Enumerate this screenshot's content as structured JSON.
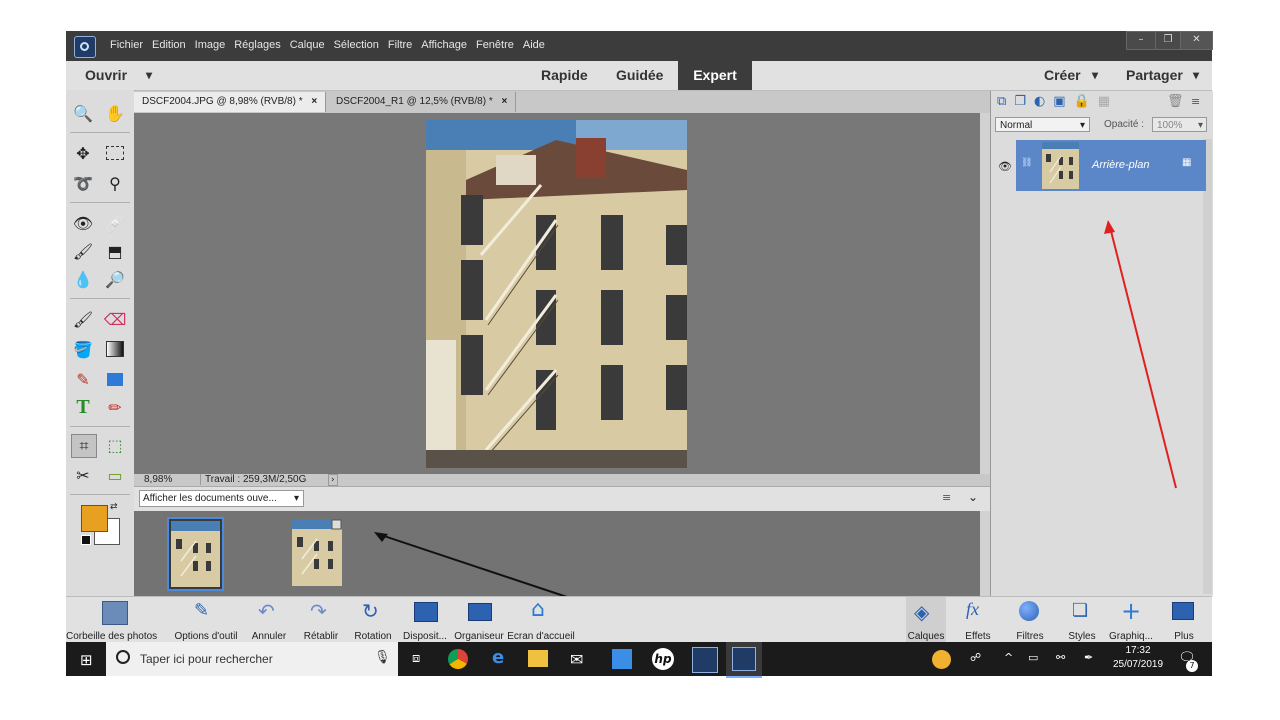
{
  "menu": {
    "items": [
      "Fichier",
      "Edition",
      "Image",
      "Réglages",
      "Calque",
      "Sélection",
      "Filtre",
      "Affichage",
      "Fenêtre",
      "Aide"
    ],
    "window_buttons": [
      "–",
      "❐",
      "✕"
    ]
  },
  "modebar": {
    "open_label": "Ouvrir",
    "modes": [
      "Rapide",
      "Guidée",
      "Expert"
    ],
    "active_mode": "Expert",
    "create_label": "Créer",
    "share_label": "Partager"
  },
  "tabs": [
    {
      "label": "DSCF2004.JPG @ 8,98% (RVB/8) *",
      "close": "×",
      "active": true
    },
    {
      "label": "DSCF2004_R1 @ 12,5% (RVB/8) *",
      "close": "×",
      "active": false
    }
  ],
  "status": {
    "zoom": "8,98%",
    "work": "Travail : 259,3M/2,50G"
  },
  "bin": {
    "dropdown": "Afficher les documents ouve...",
    "thumbnails": 2
  },
  "layers": {
    "blend_mode": "Normal",
    "opacity_label": "Opacité :",
    "opacity_value": "100%",
    "layer_name": "Arrière-plan"
  },
  "bottombar": {
    "left_items": [
      "Corbeille des photos",
      "Options d'outil",
      "Annuler",
      "Rétablir",
      "Rotation",
      "Disposit...",
      "Organiseur",
      "Ecran d'accueil"
    ],
    "right_items": [
      "Calques",
      "Effets",
      "Filtres",
      "Styles",
      "Graphiq...",
      "Plus"
    ]
  },
  "taskbar": {
    "search_placeholder": "Taper ici pour rechercher",
    "time": "17:32",
    "date": "25/07/2019",
    "notification_count": "7"
  },
  "colors": {
    "foreground": "#e8a020",
    "background": "#ffffff",
    "accent_blue": "#5b87c8",
    "menubar": "#3c3c3c"
  }
}
